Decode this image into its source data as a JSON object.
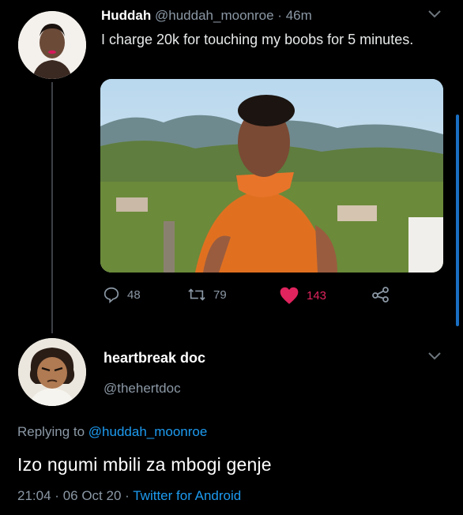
{
  "tweet": {
    "display_name": "Huddah",
    "handle": "@huddah_moonroe",
    "separator": "·",
    "time": "46m",
    "text": "I charge 20k for touching my boobs for 5 minutes.",
    "stats": {
      "replies": "48",
      "retweets": "79",
      "likes": "143"
    },
    "colors": {
      "like": "#e0245e",
      "muted": "#8b98a5"
    }
  },
  "reply": {
    "display_name": "heartbreak doc",
    "handle": "@thehertdoc",
    "replying_prefix": "Replying to",
    "replying_to": "@huddah_moonroe",
    "text": "Izo ngumi mbili za mbogi genje",
    "time": "21:04",
    "date": "06 Oct 20",
    "separator": "·",
    "client": "Twitter for Android"
  },
  "icons": [
    "chevron-down-icon",
    "reply-icon",
    "retweet-icon",
    "heart-icon",
    "share-icon"
  ],
  "theme": {
    "background": "#000000",
    "link": "#1d9bf0",
    "scrollbar": "#1a6fc2"
  }
}
